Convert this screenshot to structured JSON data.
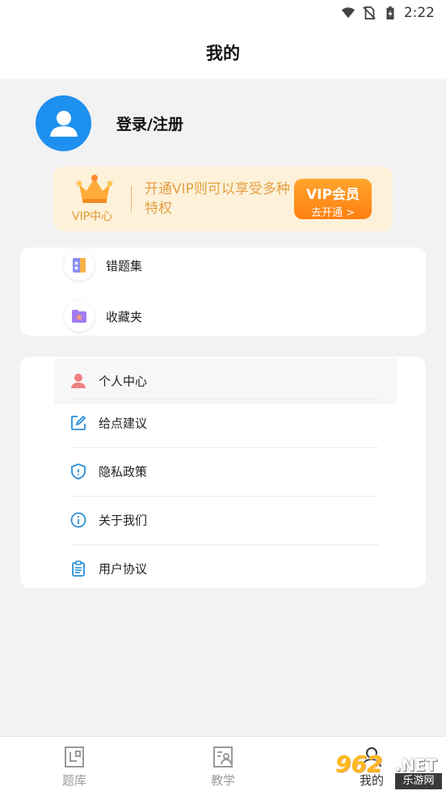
{
  "status_bar": {
    "time": "2:22",
    "icons": [
      "wifi-icon",
      "no-sim-icon",
      "battery-charging-icon"
    ]
  },
  "header": {
    "title": "我的"
  },
  "profile": {
    "login_label": "登录/注册",
    "avatar_icon": "user-avatar-icon"
  },
  "vip": {
    "center_label": "VIP中心",
    "description": "开通VIP则可以享受多种特权",
    "button_main": "VIP会员",
    "button_sub": "去开通 >",
    "crown_icon": "crown-icon",
    "accent_color": "#ff8a14"
  },
  "quick_items": [
    {
      "label": "错题集",
      "icon": "notebook-icon"
    },
    {
      "label": "收藏夹",
      "icon": "star-folder-icon"
    }
  ],
  "menu": [
    {
      "label": "个人中心",
      "icon": "person-icon"
    },
    {
      "label": "给点建议",
      "icon": "edit-icon"
    },
    {
      "label": "隐私政策",
      "icon": "shield-icon"
    },
    {
      "label": "关于我们",
      "icon": "info-icon"
    },
    {
      "label": "用户协议",
      "icon": "clipboard-icon"
    }
  ],
  "bottom_nav": [
    {
      "label": "题库",
      "icon": "question-bank-icon"
    },
    {
      "label": "教学",
      "icon": "teaching-icon"
    },
    {
      "label": "我的",
      "icon": "mine-icon"
    }
  ],
  "watermark": {
    "number": "962",
    "net": ".NET",
    "site_name": "乐游网"
  }
}
